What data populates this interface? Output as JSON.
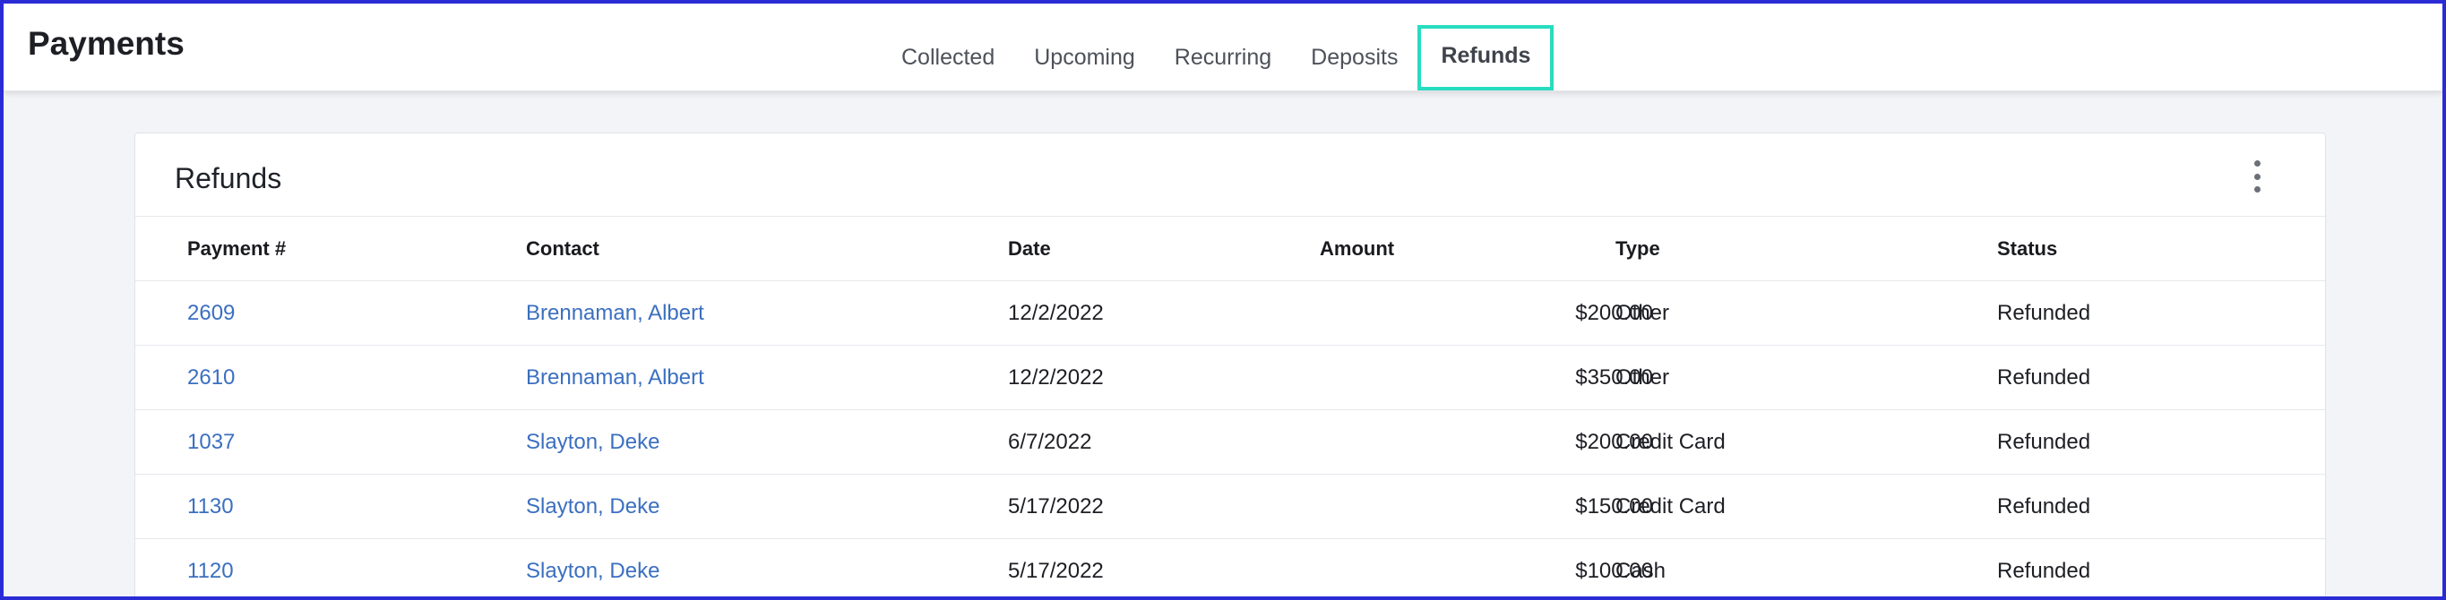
{
  "app": {
    "title": "Payments"
  },
  "tabs": [
    {
      "label": "Collected",
      "active": false
    },
    {
      "label": "Upcoming",
      "active": false
    },
    {
      "label": "Recurring",
      "active": false
    },
    {
      "label": "Deposits",
      "active": false
    },
    {
      "label": "Refunds",
      "active": true
    }
  ],
  "card": {
    "title": "Refunds",
    "menu_icon": "kebab-menu-icon"
  },
  "table": {
    "columns": [
      "Payment #",
      "Contact",
      "Date",
      "Amount",
      "Type",
      "Status"
    ],
    "rows": [
      {
        "payment": "2609",
        "contact": "Brennaman, Albert",
        "date": "12/2/2022",
        "amount": "$200.00",
        "type": "Other",
        "status": "Refunded"
      },
      {
        "payment": "2610",
        "contact": "Brennaman, Albert",
        "date": "12/2/2022",
        "amount": "$350.00",
        "type": "Other",
        "status": "Refunded"
      },
      {
        "payment": "1037",
        "contact": "Slayton, Deke",
        "date": "6/7/2022",
        "amount": "$200.00",
        "type": "Credit Card",
        "status": "Refunded"
      },
      {
        "payment": "1130",
        "contact": "Slayton, Deke",
        "date": "5/17/2022",
        "amount": "$150.00",
        "type": "Credit Card",
        "status": "Refunded"
      },
      {
        "payment": "1120",
        "contact": "Slayton, Deke",
        "date": "5/17/2022",
        "amount": "$100.00",
        "type": "Cash",
        "status": "Refunded"
      }
    ]
  },
  "colors": {
    "frame_border": "#2b2bd6",
    "active_tab_highlight": "#28dcc0",
    "link": "#3b6fc0",
    "background": "#f3f4f7"
  }
}
